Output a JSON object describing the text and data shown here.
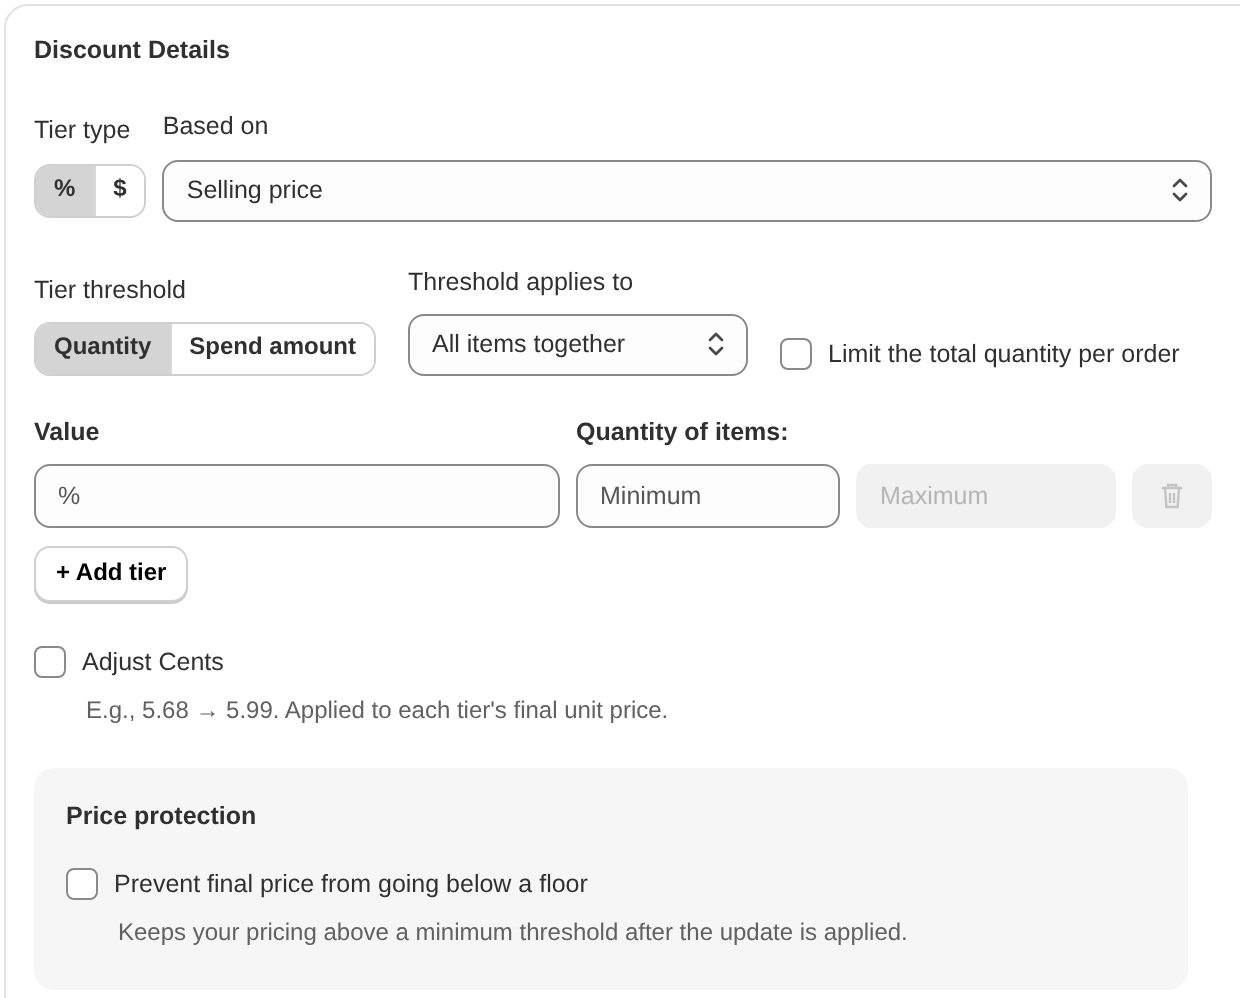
{
  "title": "Discount Details",
  "tier_type": {
    "label": "Tier type",
    "options": [
      {
        "label": "%",
        "selected": true
      },
      {
        "label": "$",
        "selected": false
      }
    ]
  },
  "based_on": {
    "label": "Based on",
    "value": "Selling price"
  },
  "tier_threshold": {
    "label": "Tier threshold",
    "options": [
      {
        "label": "Quantity",
        "selected": true
      },
      {
        "label": "Spend amount",
        "selected": false
      }
    ]
  },
  "threshold_applies_to": {
    "label": "Threshold applies to",
    "value": "All items together"
  },
  "limit_quantity": {
    "label": "Limit the total quantity per order",
    "checked": false
  },
  "tier_row": {
    "value_label": "Value",
    "quantity_label": "Quantity of items:",
    "value_field": {
      "placeholder": "%",
      "disabled": false
    },
    "minimum_field": {
      "placeholder": "Minimum",
      "disabled": false
    },
    "maximum_field": {
      "placeholder": "Maximum",
      "disabled": true
    },
    "delete_disabled": true
  },
  "add_tier_button": "+ Add tier",
  "adjust_cents": {
    "label": "Adjust Cents",
    "checked": false,
    "hint": "E.g., 5.68 → 5.99. Applied to each tier's final unit price."
  },
  "price_protection": {
    "title": "Price protection",
    "label": "Prevent final price from going below a floor",
    "checked": false,
    "hint": "Keeps your pricing above a minimum threshold after the update is applied."
  }
}
